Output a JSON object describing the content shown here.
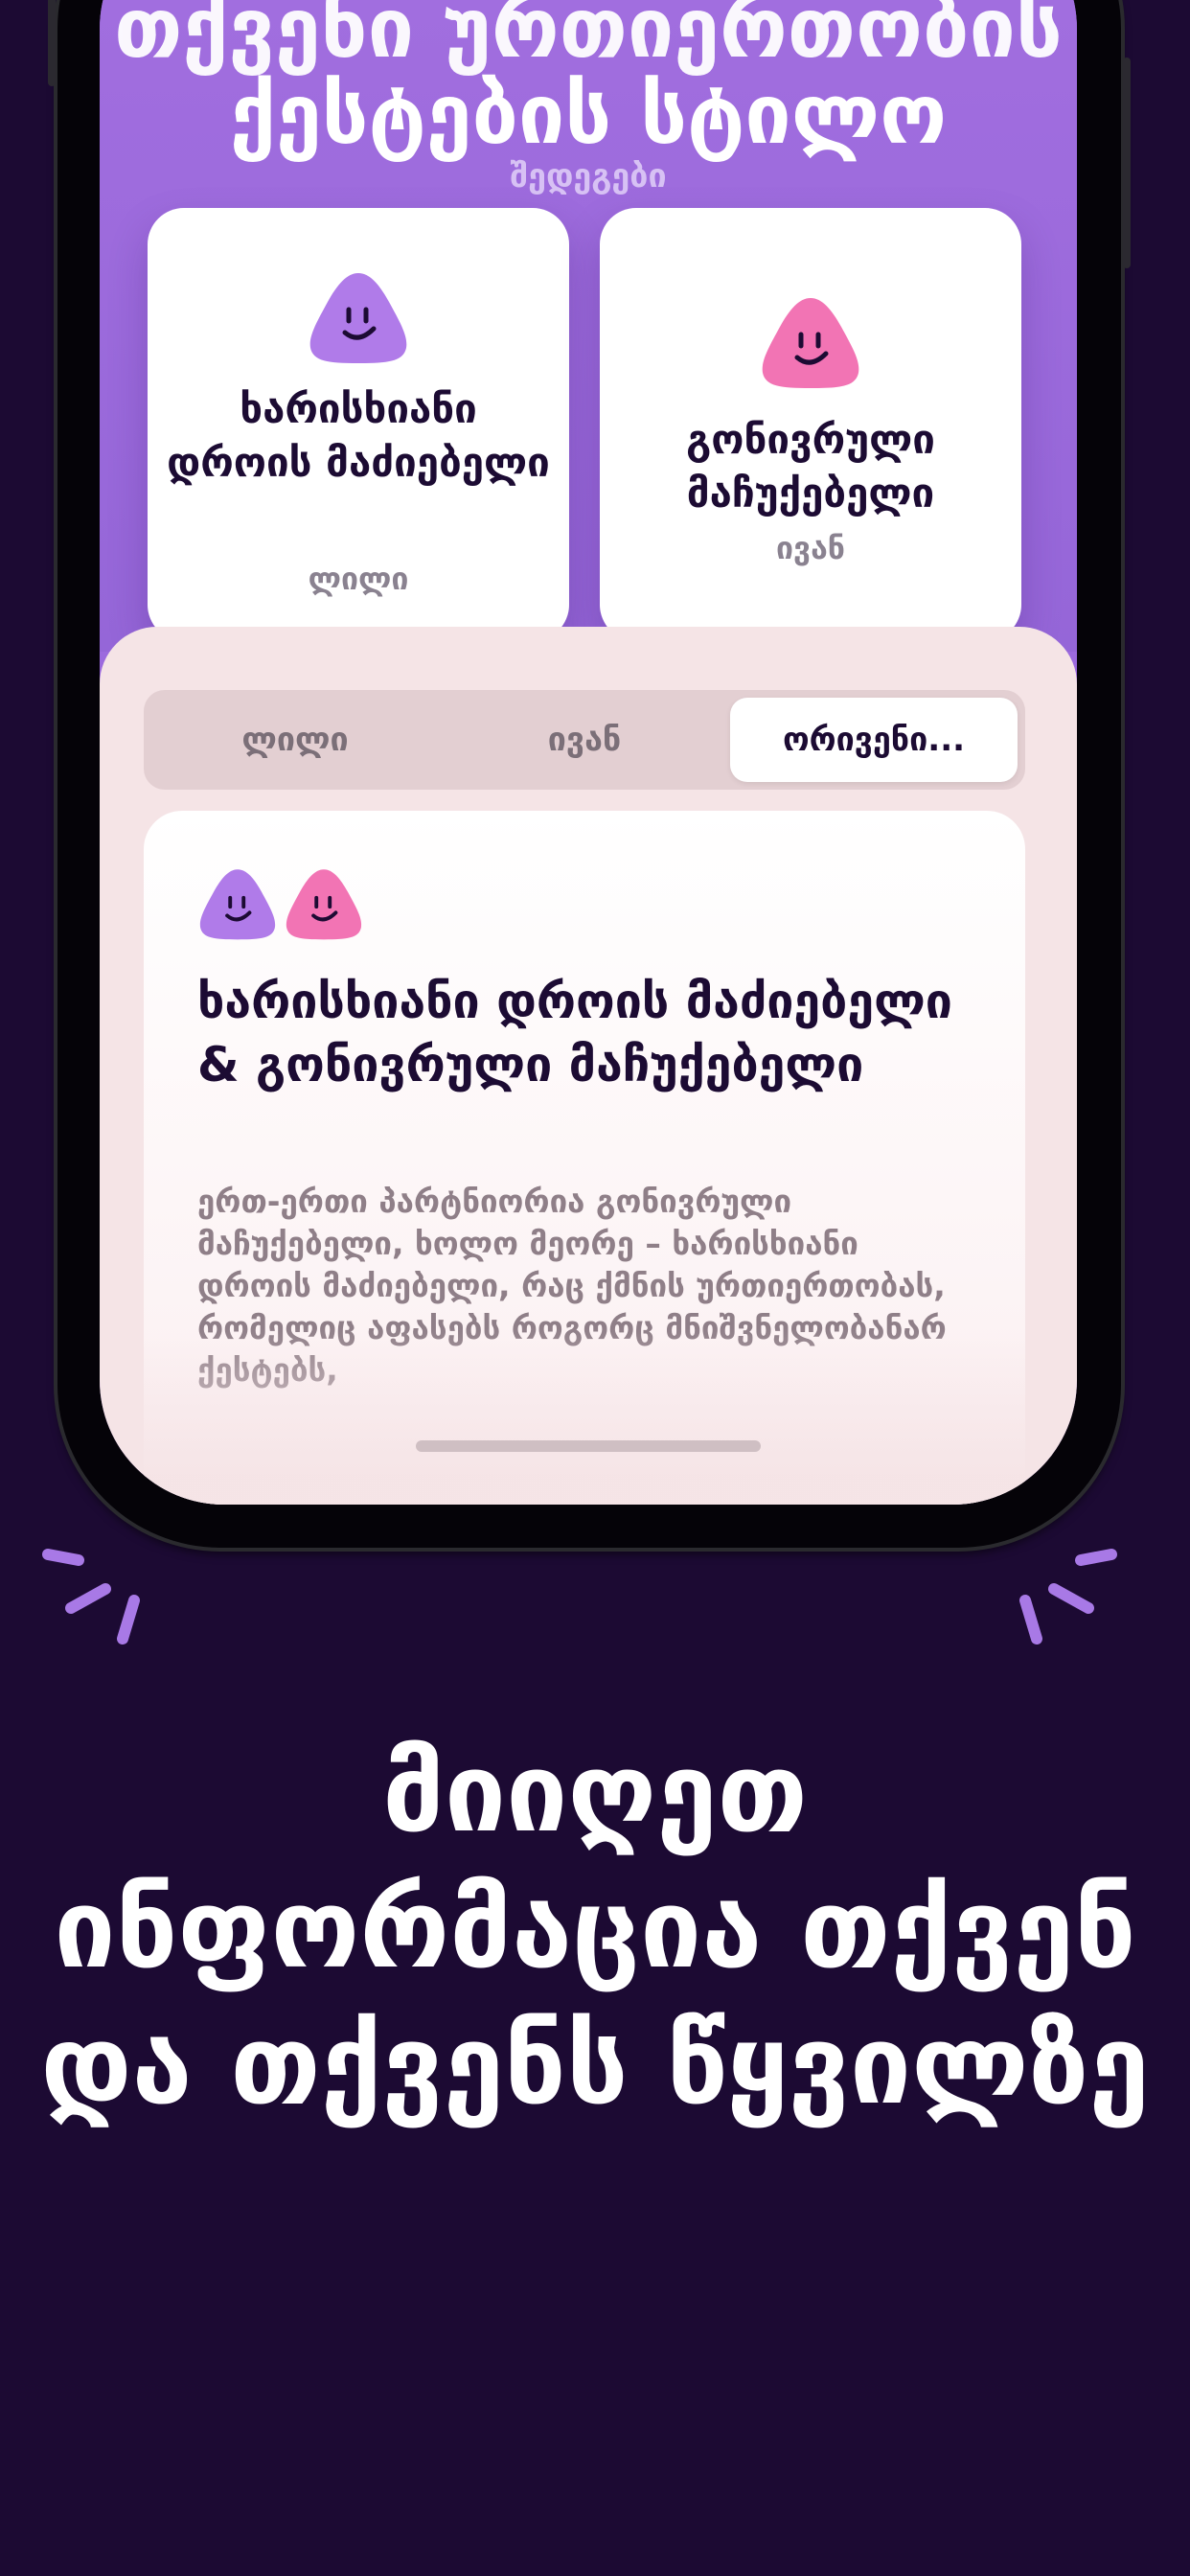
{
  "hero": {
    "title_line1": "თქვენი ურთიერთობის",
    "title_line2": "ქესტების სტილო",
    "subtitle": "შედეგები"
  },
  "partners": [
    {
      "title": "ხარისხიანი დროის მაძიებელი",
      "name": "ლილი",
      "blob_color": "#b07be9"
    },
    {
      "title": "გონივრული მაჩუქებელი",
      "name": "ივან",
      "blob_color": "#f274b4"
    }
  ],
  "tabs": [
    "ლილი",
    "ივან",
    "ორივენი..."
  ],
  "active_tab": "ორივენი...",
  "detail": {
    "title": "ხარისხიანი დროის მაძიებელი & გონივრული მაჩუქებელი",
    "description": "ერთ-ერთი პარტნიორია გონივრული მაჩუქებელი, ხოლო მეორე – ხარისხიანი დროის მაძიებელი, რაც ქმნის ურთიერთობას, რომელიც აფასებს როგორც მნიშვნელობანარ ქესტებს,"
  },
  "caption": "მიიღეთ ინფორმაცია თქვენ და თქვენს წყვილზე",
  "colors": {
    "background": "#1c0a33",
    "hero": "#9c6ade",
    "sheet": "#f5e4e6",
    "accent_purple": "#b07be9",
    "accent_pink": "#f274b4"
  }
}
